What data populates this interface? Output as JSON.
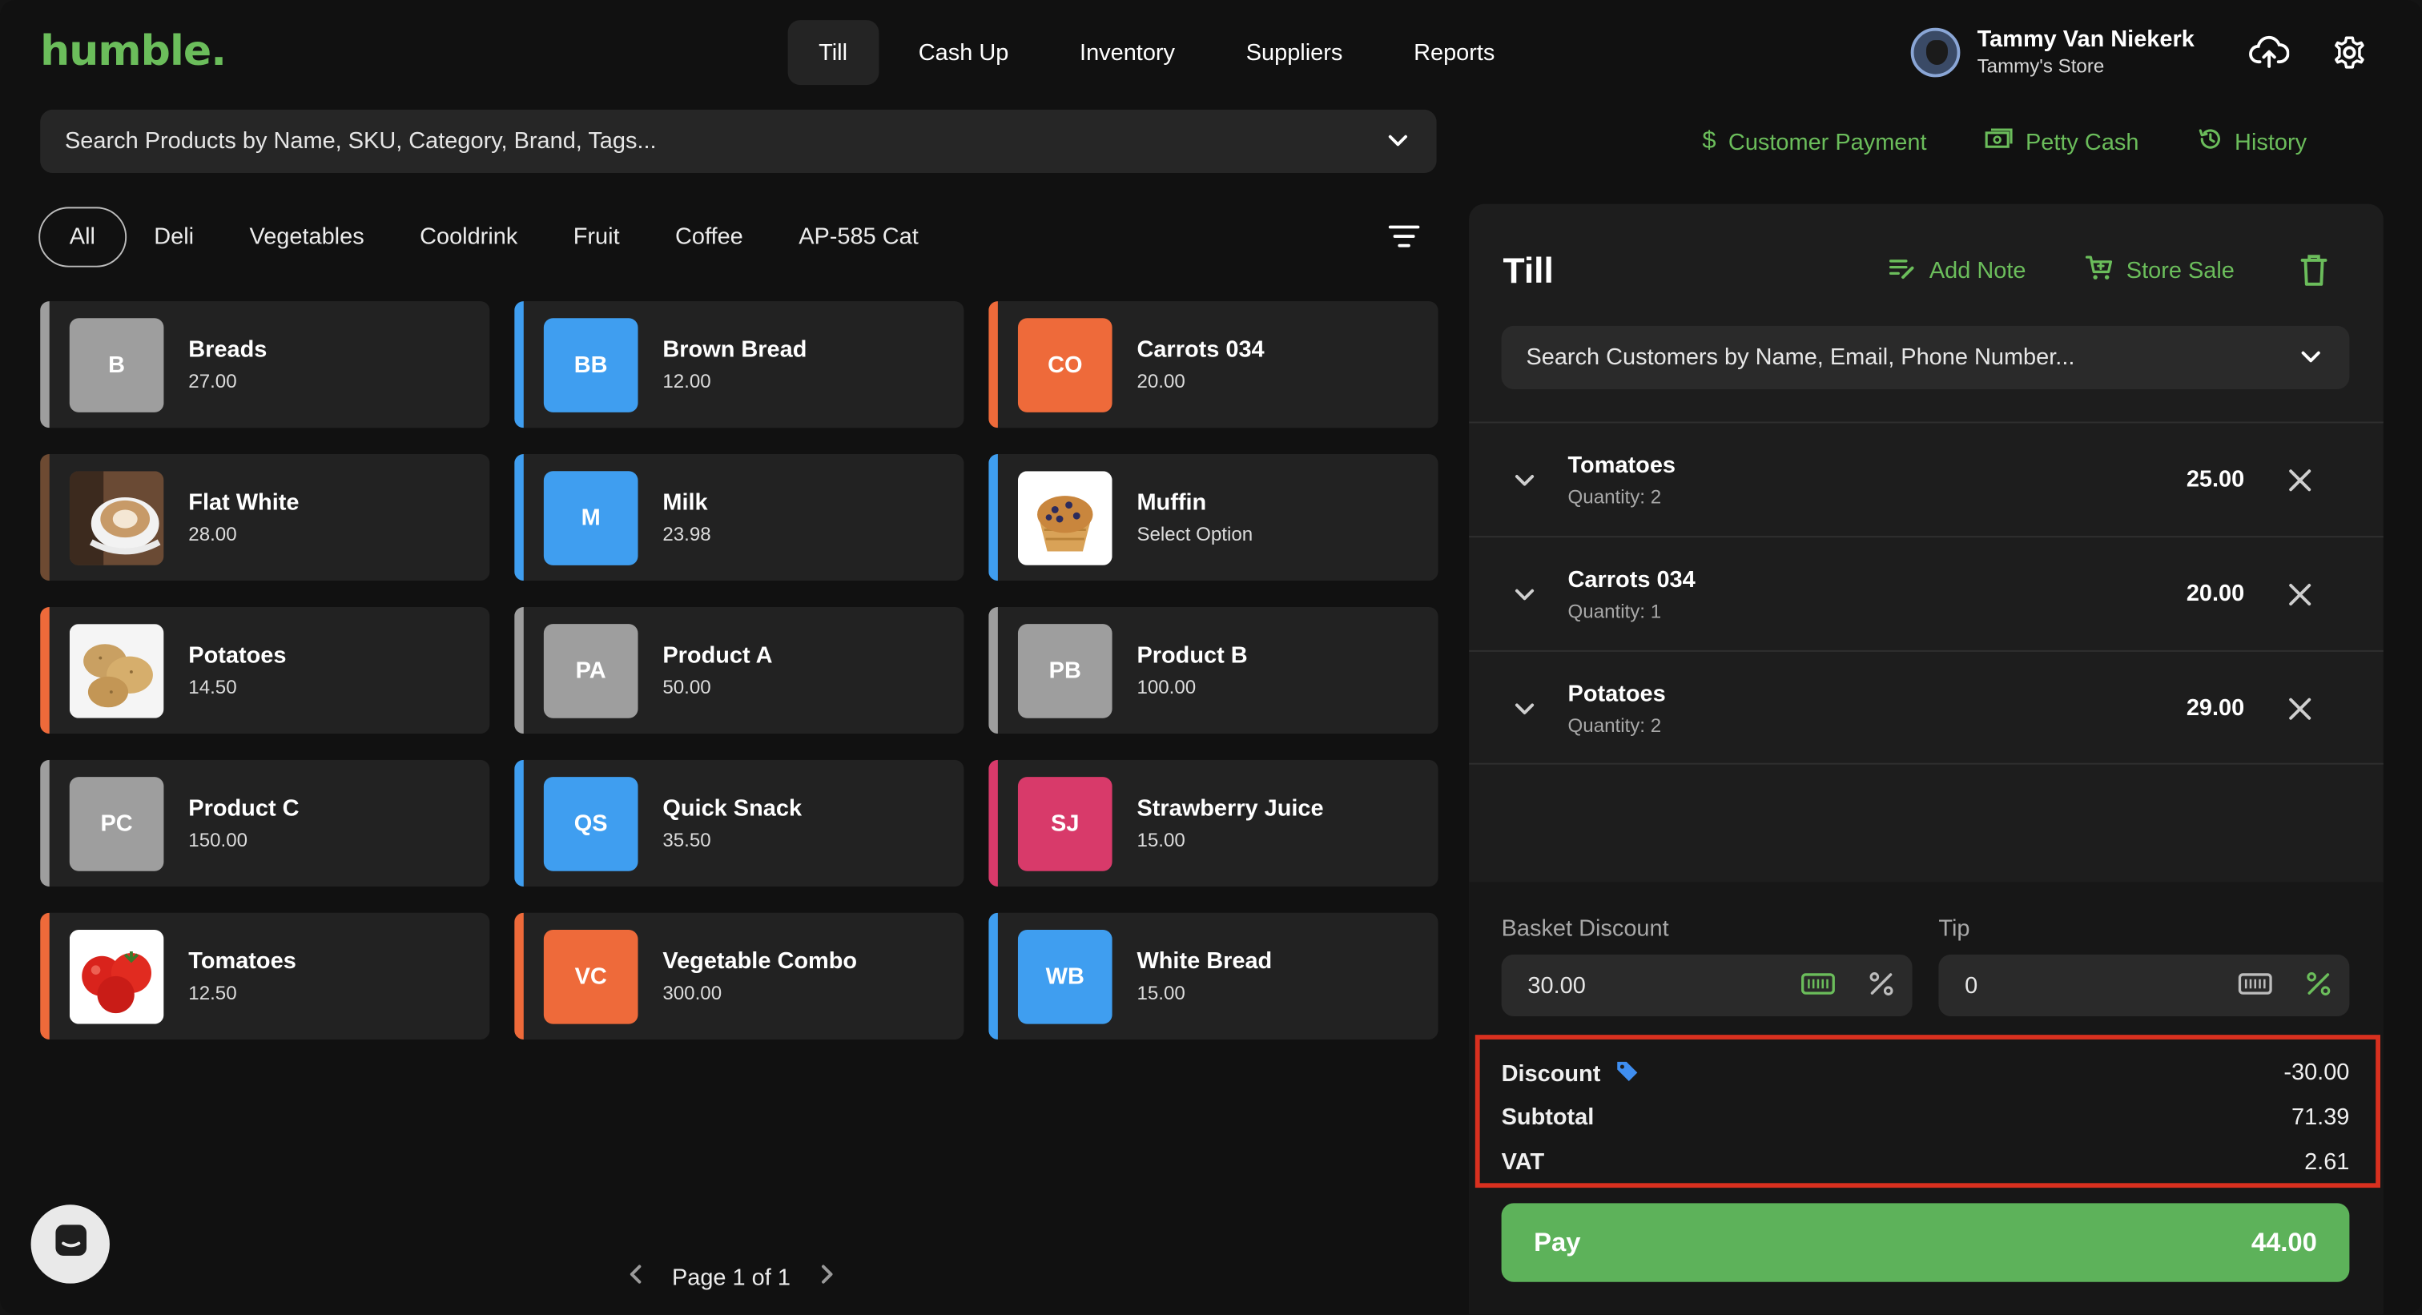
{
  "app": {
    "logo": "humble."
  },
  "nav": {
    "items": [
      {
        "label": "Till",
        "active": true
      },
      {
        "label": "Cash Up"
      },
      {
        "label": "Inventory"
      },
      {
        "label": "Suppliers"
      },
      {
        "label": "Reports"
      }
    ]
  },
  "user": {
    "name": "Tammy Van Niekerk",
    "store": "Tammy's Store"
  },
  "header_icons": {
    "upload": "cloud-upload-icon",
    "settings": "gear-icon"
  },
  "product_search": {
    "placeholder": "Search Products by Name, SKU, Category, Brand, Tags..."
  },
  "quick_links": {
    "customer_payment": "Customer Payment",
    "petty_cash": "Petty Cash",
    "history": "History"
  },
  "categories": [
    "All",
    "Deli",
    "Vegetables",
    "Cooldrink",
    "Fruit",
    "Coffee",
    "AP-585 Cat"
  ],
  "products": [
    {
      "name": "Breads",
      "price": "27.00",
      "initials": "B",
      "color": "#9e9e9e",
      "strip": "#9e9e9e"
    },
    {
      "name": "Brown Bread",
      "price": "12.00",
      "initials": "BB",
      "color": "#3f9ef0",
      "strip": "#3f9ef0"
    },
    {
      "name": "Carrots 034",
      "price": "20.00",
      "initials": "CO",
      "color": "#ee6a3a",
      "strip": "#ee6a3a"
    },
    {
      "name": "Flat White",
      "price": "28.00",
      "initials": "",
      "image": "coffee",
      "strip": "#6d4a32"
    },
    {
      "name": "Milk",
      "price": "23.98",
      "initials": "M",
      "color": "#3f9ef0",
      "strip": "#3f9ef0"
    },
    {
      "name": "Muffin",
      "price": "Select Option",
      "initials": "",
      "image": "muffin",
      "strip": "#3f9ef0"
    },
    {
      "name": "Potatoes",
      "price": "14.50",
      "initials": "",
      "image": "potatoes",
      "strip": "#ee6a3a"
    },
    {
      "name": "Product A",
      "price": "50.00",
      "initials": "PA",
      "color": "#9e9e9e",
      "strip": "#9e9e9e"
    },
    {
      "name": "Product B",
      "price": "100.00",
      "initials": "PB",
      "color": "#9e9e9e",
      "strip": "#9e9e9e"
    },
    {
      "name": "Product C",
      "price": "150.00",
      "initials": "PC",
      "color": "#9e9e9e",
      "strip": "#9e9e9e"
    },
    {
      "name": "Quick Snack",
      "price": "35.50",
      "initials": "QS",
      "color": "#3f9ef0",
      "strip": "#3f9ef0"
    },
    {
      "name": "Strawberry Juice",
      "price": "15.00",
      "initials": "SJ",
      "color": "#d83a6a",
      "strip": "#d83a6a"
    },
    {
      "name": "Tomatoes",
      "price": "12.50",
      "initials": "",
      "image": "tomatoes",
      "strip": "#ee6a3a"
    },
    {
      "name": "Vegetable Combo",
      "price": "300.00",
      "initials": "VC",
      "color": "#ee6a3a",
      "strip": "#ee6a3a"
    },
    {
      "name": "White Bread",
      "price": "15.00",
      "initials": "WB",
      "color": "#3f9ef0",
      "strip": "#3f9ef0"
    }
  ],
  "pager": {
    "label": "Page 1 of 1"
  },
  "till": {
    "title": "Till",
    "add_note": "Add Note",
    "store_sale": "Store Sale",
    "customer_search_placeholder": "Search Customers by Name, Email, Phone Number...",
    "basket": [
      {
        "name": "Tomatoes",
        "quantity": "Quantity: 2",
        "price": "25.00"
      },
      {
        "name": "Carrots 034",
        "quantity": "Quantity: 1",
        "price": "20.00"
      },
      {
        "name": "Potatoes",
        "quantity": "Quantity: 2",
        "price": "29.00"
      }
    ],
    "basket_discount_label": "Basket Discount",
    "basket_discount_value": "30.00",
    "tip_label": "Tip",
    "tip_value": "0",
    "totals": {
      "discount_label": "Discount",
      "discount_value": "-30.00",
      "subtotal_label": "Subtotal",
      "subtotal_value": "71.39",
      "vat_label": "VAT",
      "vat_value": "2.61"
    },
    "pay_label": "Pay",
    "pay_amount": "44.00"
  },
  "colors": {
    "accent": "#6bbd5b",
    "highlight": "#d9301f",
    "pay": "#5db25a"
  }
}
